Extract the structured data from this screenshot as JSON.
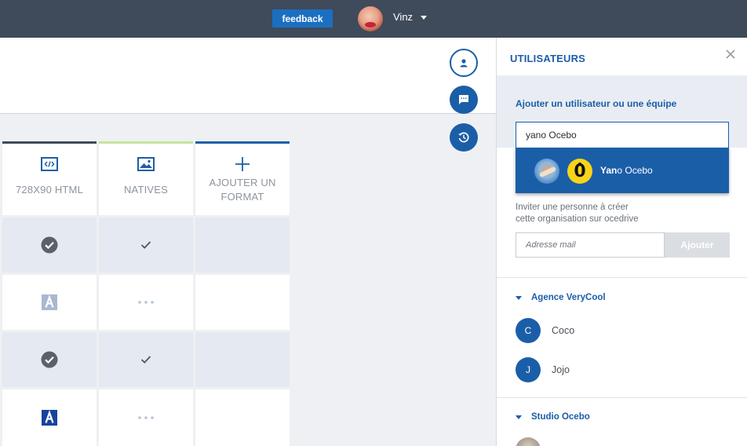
{
  "topbar": {
    "feedback_label": "feedback",
    "user_name": "Vinz"
  },
  "grid": {
    "columns": [
      {
        "label": "728X90 HTML",
        "icon": "code-icon",
        "bar_color": "#3f4a5a"
      },
      {
        "label": "NATIVES",
        "icon": "image-icon",
        "bar_color": "#c5e59a"
      },
      {
        "label": "AJOUTER UN FORMAT",
        "label_line1": "AJOUTER UN",
        "label_line2": "FORMAT",
        "icon": "plus-icon",
        "bar_color": "#1b5ea8"
      }
    ],
    "rows": [
      {
        "shaded": true,
        "cells": [
          "check-circle-icon",
          "check-icon",
          ""
        ]
      },
      {
        "shaded": false,
        "cells": [
          "text-a-icon-light",
          "ellipsis-icon",
          ""
        ]
      },
      {
        "shaded": true,
        "cells": [
          "check-circle-icon",
          "check-icon",
          ""
        ]
      },
      {
        "shaded": false,
        "cells": [
          "text-a-icon-dark",
          "ellipsis-icon",
          ""
        ]
      }
    ]
  },
  "panel": {
    "title": "UTILISATEURS",
    "add_label": "Ajouter un utilisateur ou une équipe",
    "search_value": "yano Ocebo",
    "suggestion": {
      "highlight": "Yan",
      "rest": "o Ocebo"
    },
    "invite_line1": "Inviter une personne à créer",
    "invite_line2": "cette organisation sur ocedrive",
    "mail_placeholder": "Adresse mail",
    "add_button": "Ajouter",
    "groups": [
      {
        "name": "Agence VeryCool",
        "members": [
          {
            "initial": "C",
            "name": "Coco"
          },
          {
            "initial": "J",
            "name": "Jojo"
          }
        ]
      },
      {
        "name": "Studio Ocebo",
        "members": []
      }
    ]
  },
  "colors": {
    "topbar": "#3f4a5a",
    "accent": "#1b5ea8",
    "feedback": "#1b6fc0",
    "natives_bar": "#c5e59a"
  }
}
